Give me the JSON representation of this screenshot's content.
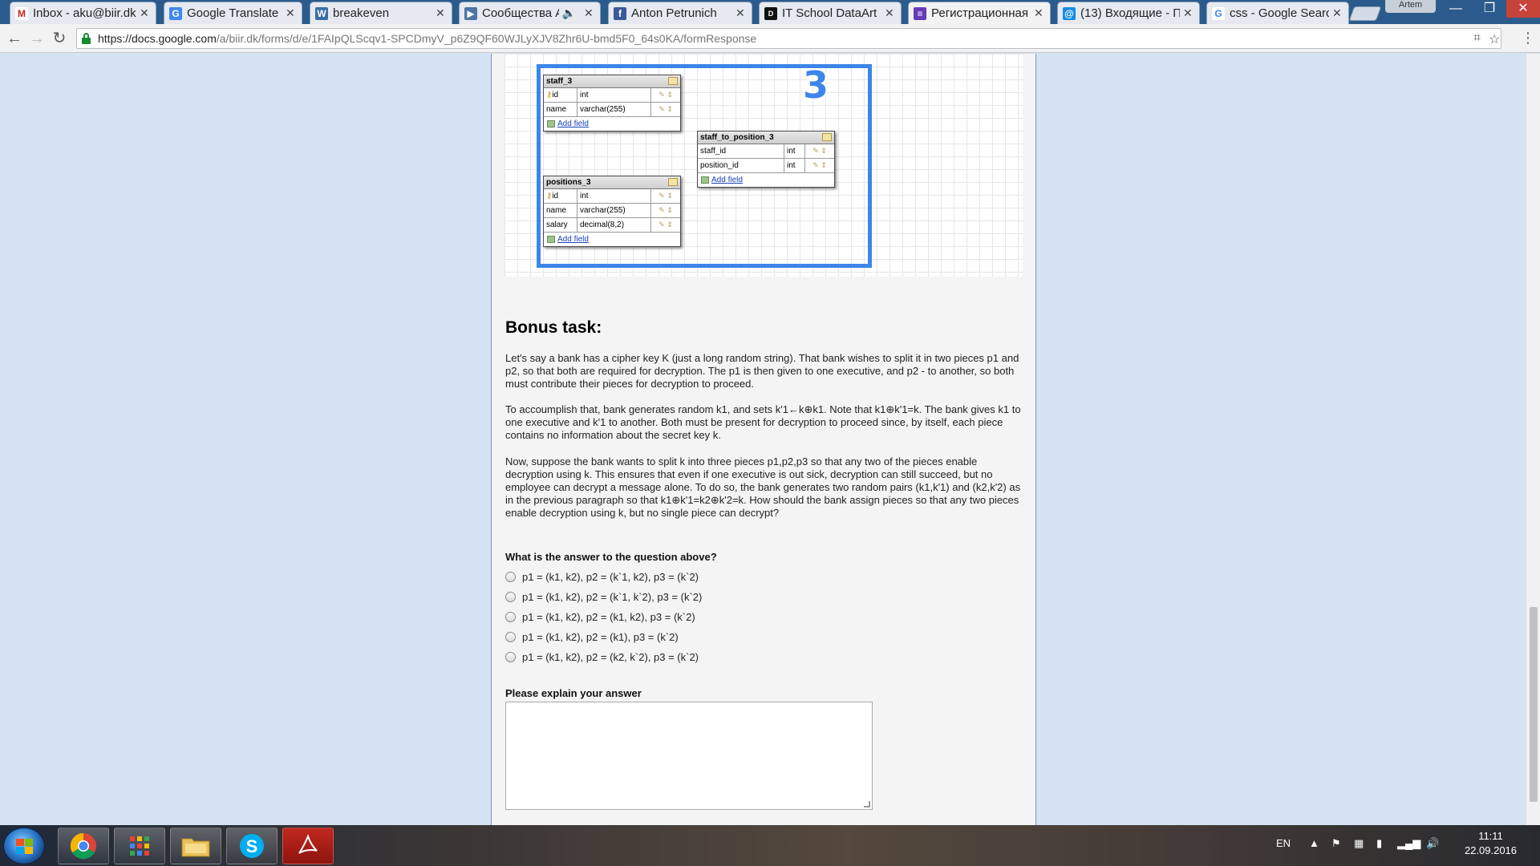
{
  "browser": {
    "tabs": [
      {
        "title": "Inbox - aku@biir.dk",
        "icon": "gmail-icon",
        "color": "#c5221f",
        "glyph": "M"
      },
      {
        "title": "Google Translate",
        "icon": "translate-icon",
        "color": "#4285f4",
        "glyph": "G"
      },
      {
        "title": "breakeven",
        "icon": "wiki-icon",
        "color": "#3b6ea8",
        "glyph": "W"
      },
      {
        "title": "Сообщества Ар",
        "icon": "vk-icon",
        "color": "#4c75a3",
        "glyph": "▶"
      },
      {
        "title": "Anton Petrunich",
        "icon": "facebook-icon",
        "color": "#3b5998",
        "glyph": "f"
      },
      {
        "title": "IT School DataArt",
        "icon": "dou-icon",
        "color": "#111111",
        "glyph": "D"
      },
      {
        "title": "Регистрационная",
        "icon": "forms-icon",
        "color": "#673ab7",
        "glyph": "≡"
      },
      {
        "title": "(13) Входящие - П",
        "icon": "mail-icon",
        "color": "#168de2",
        "glyph": "@"
      },
      {
        "title": "css - Google Searc",
        "icon": "google-icon",
        "color": "#4285f4",
        "glyph": "G"
      }
    ],
    "profile_name": "Artem",
    "url_domain": "https://docs.google.com",
    "url_path": "/a/biir.dk/forms/d/e/1FAIpQLScqv1-SPCDmyV_p6Z9QF60WJLyXJV8Zhr6U-bmd5F0_64s0KA/formResponse"
  },
  "diagram": {
    "badge": "3",
    "add_field": "Add field",
    "tables": [
      {
        "name": "staff_3",
        "rows": [
          [
            "id",
            "int"
          ],
          [
            "name",
            "varchar(255)"
          ]
        ]
      },
      {
        "name": "staff_to_position_3",
        "rows": [
          [
            "staff_id",
            "int"
          ],
          [
            "position_id",
            "int"
          ]
        ]
      },
      {
        "name": "positions_3",
        "rows": [
          [
            "id",
            "int"
          ],
          [
            "name",
            "varchar(255)"
          ],
          [
            "salary",
            "decimal(8,2)"
          ]
        ]
      }
    ]
  },
  "form": {
    "heading": "Bonus task:",
    "paragraphs": [
      "Let's say a bank has a cipher key K (just a long random string). That bank wishes to split it in two pieces p1 and p2, so that both are required for decryption. The p1 is then given to one executive, and p2 - to another, so both must contribute their pieces for decryption to proceed.",
      "To accoumplish that, bank generates random k1, and sets k'1←k⊕k1. Note that k1⊕k'1=k. The bank gives k1 to one executive and k'1 to another. Both must be present for decryption to proceed since, by itself, each piece contains no information about the secret key k.",
      "Now, suppose the bank wants to split k into three pieces p1,p2,p3 so that any two of the pieces enable decryption using k. This ensures that even if one executive is out sick, decryption can still succeed, but no employee can decrypt a message alone. To do so, the bank generates two random pairs (k1,k'1) and (k2,k'2) as in the previous paragraph so that k1⊕k'1=k2⊕k'2=k. How should the bank assign pieces so that any two pieces enable decryption using k, but no single piece can decrypt?"
    ],
    "question": "What is the answer to the question above?",
    "options": [
      "p1 = (k1, k2), p2 = (k`1, k2), p3 = (k`2)",
      "p1 = (k1, k2), p2 = (k`1, k`2), p3 = (k`2)",
      "p1 = (k1, k2), p2 = (k1, k2), p3 = (k`2)",
      "p1 = (k1, k2), p2 = (k1), p3 = (k`2)",
      "p1 = (k1, k2), p2 = (k2, k`2), p3 = (k`2)"
    ],
    "explain_label": "Please explain your answer",
    "explain_value": ""
  },
  "taskbar": {
    "language": "EN",
    "time": "11:11",
    "date": "22.09.2016"
  }
}
